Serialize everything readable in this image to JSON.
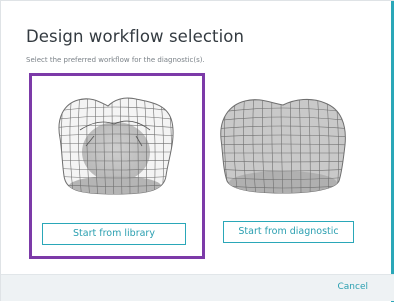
{
  "dialog": {
    "title": "Design workflow selection",
    "subtitle": "Select the preferred workflow for the diagnostic(s).",
    "options": [
      {
        "label": "Start from library",
        "selected": true
      },
      {
        "label": "Start from diagnostic",
        "selected": false
      }
    ],
    "cancel_label": "Cancel"
  },
  "colors": {
    "accent": "#2aa7b8",
    "selection_border": "#7c3aa8",
    "footer_bg": "#eef2f4"
  },
  "icons": [
    "library-tooth-mesh-icon",
    "diagnostic-tooth-mesh-icon"
  ]
}
